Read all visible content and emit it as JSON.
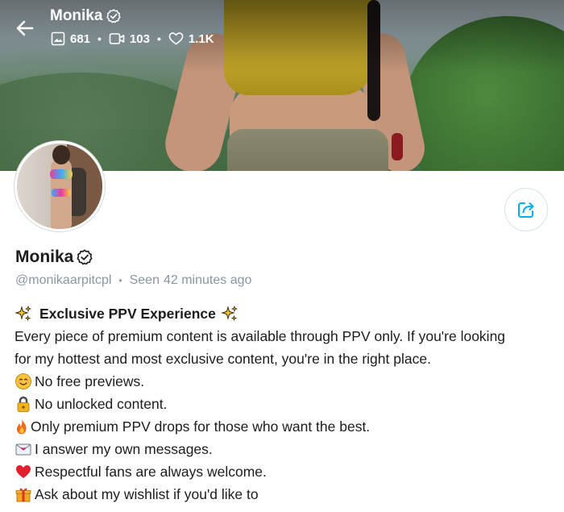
{
  "header": {
    "name": "Monika",
    "stats": [
      {
        "icon": "image-icon",
        "value": "681"
      },
      {
        "icon": "video-icon",
        "value": "103"
      },
      {
        "icon": "heart-icon",
        "value": "1.1K"
      }
    ],
    "separator": "•"
  },
  "profile": {
    "name": "Monika",
    "username": "@monikaarpitcpl",
    "separator": "•",
    "seen_label": "Seen",
    "seen_time": "42 minutes ago"
  },
  "bio": {
    "title": "Exclusive PPV Experience",
    "lines": [
      "Every piece of premium content is available through PPV only. If you're looking",
      "for my hottest and most exclusive content, you're in the right place.",
      "No free previews.",
      "No unlocked content.",
      "Only premium PPV drops for those who want the best.",
      " I answer my own messages.",
      " Respectful fans are always welcome.",
      " Ask about my wishlist if you'd like to"
    ]
  },
  "colors": {
    "accent": "#00aff0",
    "muted": "#8a96a3",
    "text": "#1c1c1c"
  }
}
